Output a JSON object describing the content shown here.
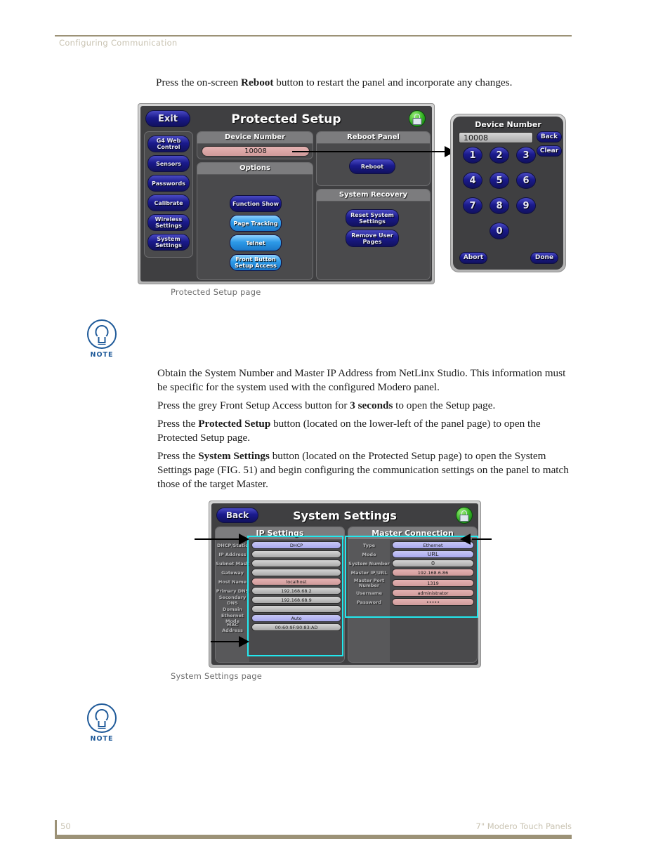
{
  "header": {
    "section_title": "Configuring Communication"
  },
  "footer": {
    "page_number": "50",
    "book_title": "7\" Modero Touch Panels"
  },
  "body": {
    "intro": "Press the on-screen Reboot button to restart the panel and incorporate any changes.",
    "intro_pre": "Press the on-screen ",
    "intro_bold": "Reboot",
    "intro_post": " button to restart the panel and incorporate any changes.",
    "p1": "Obtain the System Number and Master IP Address from NetLinx Studio. This information must be specific for the system used with the configured Modero panel.",
    "p2_pre": "Press the grey Front Setup Access button for ",
    "p2_bold": "3 seconds",
    "p2_post": " to open the Setup page.",
    "p3_pre": "Press the ",
    "p3_bold": "Protected Setup",
    "p3_post": " button (located on the lower-left of the panel page) to open the Protected Setup page.",
    "p4_pre": "Press the ",
    "p4_bold": "System Settings",
    "p4_post": " button (located on the Protected Setup page) to open the System Settings page (FIG. 51) and begin configuring the communication settings on the panel to match those of the target Master."
  },
  "captions": {
    "protected_setup": "Protected Setup page",
    "system_settings": "System Settings page"
  },
  "note": {
    "label": "NOTE"
  },
  "protected_setup": {
    "title": "Protected Setup",
    "exit_button": "Exit",
    "lock_icon": "lock-icon",
    "sidebar": [
      "G4 Web Control",
      "Sensors",
      "Passwords",
      "Calibrate",
      "Wireless Settings",
      "System Settings"
    ],
    "device_number": {
      "header": "Device Number",
      "value": "10008"
    },
    "options": {
      "header": "Options",
      "buttons": [
        {
          "label": "Function Show",
          "style": "dark"
        },
        {
          "label": "Page Tracking",
          "style": "light"
        },
        {
          "label": "Telnet",
          "style": "light"
        },
        {
          "label": "Front Button Setup Access",
          "style": "light"
        }
      ]
    },
    "reboot_panel": {
      "header": "Reboot Panel",
      "button": "Reboot"
    },
    "system_recovery": {
      "header": "System Recovery",
      "buttons": [
        "Reset System Settings",
        "Remove User Pages"
      ]
    }
  },
  "keypad": {
    "title": "Device Number",
    "value": "10008",
    "back_button": "Back",
    "clear_button": "Clear",
    "keys": [
      "1",
      "2",
      "3",
      "4",
      "5",
      "6",
      "7",
      "8",
      "9",
      "0"
    ],
    "abort_button": "Abort",
    "done_button": "Done"
  },
  "system_settings": {
    "title": "System Settings",
    "back_button": "Back",
    "lock_icon": "lock-icon",
    "ip_settings": {
      "header": "IP Settings",
      "rows": [
        {
          "label": "DHCP/Static",
          "value": "DHCP",
          "style": "blue"
        },
        {
          "label": "IP Address",
          "value": "",
          "style": "grey"
        },
        {
          "label": "Subnet Mask",
          "value": "",
          "style": "grey"
        },
        {
          "label": "Gateway",
          "value": "",
          "style": "grey"
        },
        {
          "label": "Host Name",
          "value": "localhost",
          "style": "pink"
        },
        {
          "label": "Primary DNS",
          "value": "192.168.68.2",
          "style": "grey"
        },
        {
          "label": "Secondary DNS",
          "value": "192.168.68.9",
          "style": "grey"
        },
        {
          "label": "Domain",
          "value": "",
          "style": "grey"
        },
        {
          "label": "Ethernet Mode",
          "value": "Auto",
          "style": "blue"
        },
        {
          "label": "MAC Address",
          "value": "00:60:9F:90:83:AD",
          "style": "grey"
        }
      ]
    },
    "master_connection": {
      "header": "Master Connection",
      "rows": [
        {
          "label": "Type",
          "value": "Ethernet",
          "style": "blue"
        },
        {
          "label": "Mode",
          "value": "URL",
          "style": "blue"
        },
        {
          "label": "System Number",
          "value": "0",
          "style": "grey"
        },
        {
          "label": "Master IP/URL",
          "value": "192.168.6.86",
          "style": "pink"
        },
        {
          "label": "Master Port Number",
          "value": "1319",
          "style": "pink"
        },
        {
          "label": "Username",
          "value": "administrator",
          "style": "pink"
        },
        {
          "label": "Password",
          "value": "•••••",
          "style": "pink"
        }
      ]
    }
  },
  "colors": {
    "rule": "#9c9277",
    "note_blue": "#1f5a99",
    "cyan_highlight": "#22e8ee",
    "panel_dark": "#3f3f41"
  }
}
